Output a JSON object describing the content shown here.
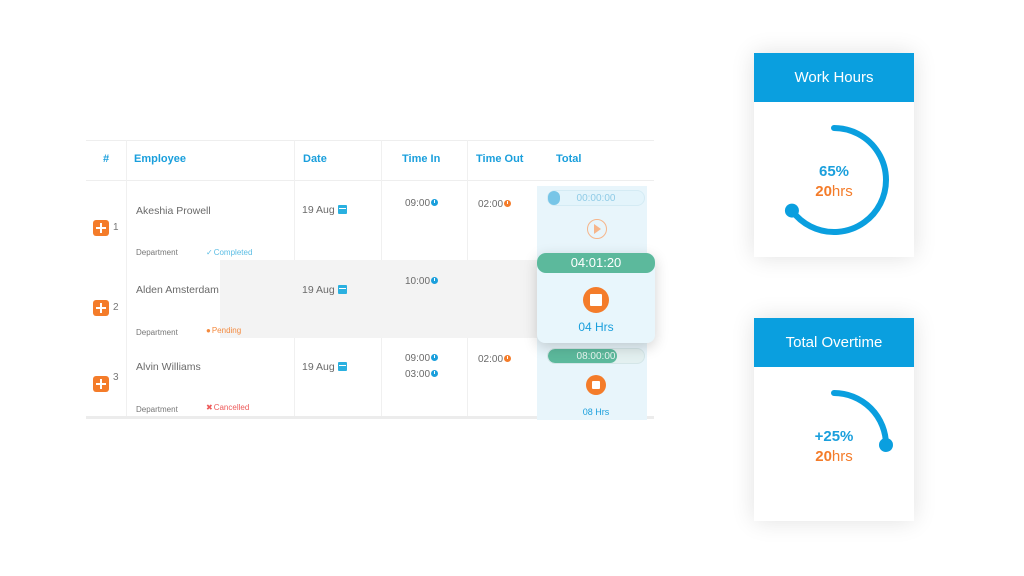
{
  "table": {
    "headers": [
      "#",
      "Employee",
      "Date",
      "Time In",
      "Time Out",
      "Total"
    ],
    "rows": [
      {
        "num": "1",
        "name": "Akeshia Prowell",
        "department": "Department",
        "status": "Completed",
        "status_icon": "check-icon",
        "date": "19 Aug",
        "time_in": [
          "09:00"
        ],
        "time_out": "02:00",
        "timer": "00:00:00",
        "timer_action": "play",
        "timer_progress": 0.0
      },
      {
        "num": "2",
        "name": "Alden Amsterdam",
        "department": "Department",
        "status": "Pending",
        "status_icon": "user-icon",
        "date": "19 Aug",
        "time_in": [
          "10:00"
        ],
        "time_out": "",
        "timer": "04:01:20",
        "timer_action": "stop",
        "total_hours": "04 Hrs"
      },
      {
        "num": "3",
        "name": "Alvin Williams",
        "department": "Department",
        "status": "Cancelled",
        "status_icon": "x-icon",
        "date": "19 Aug",
        "time_in": [
          "09:00",
          "03:00"
        ],
        "time_out": "02:00",
        "timer": "08:00:00",
        "timer_action": "stop",
        "timer_progress": 0.72,
        "total_hours": "08 Hrs"
      }
    ]
  },
  "cards": [
    {
      "title": "Work Hours",
      "percent_label": "65%",
      "percent_value": 65,
      "hours_value": "20",
      "hours_unit": "hrs"
    },
    {
      "title": "Total Overtime",
      "percent_label": "+25%",
      "percent_value": 25,
      "hours_value": "20",
      "hours_unit": "hrs"
    }
  ],
  "colors": {
    "accent_blue": "#0a9fdf",
    "accent_orange": "#f47c2a",
    "timer_green": "#5cb99c",
    "completed": "#5bbde4",
    "pending": "#f48a3e",
    "cancelled": "#ee5a5a"
  }
}
